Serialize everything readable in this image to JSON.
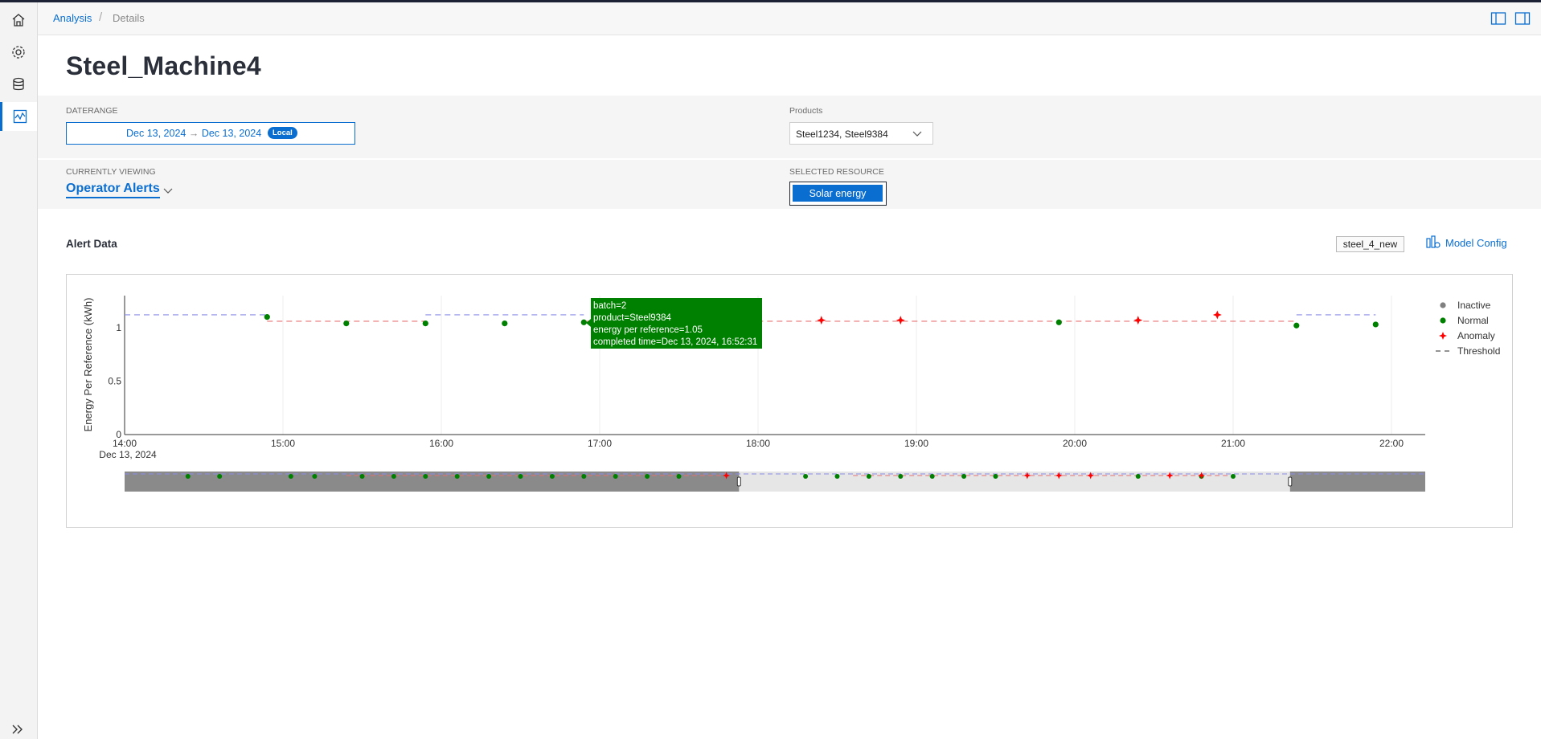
{
  "breadcrumb": {
    "link": "Analysis",
    "separator": "/",
    "current": "Details"
  },
  "page_title": "Steel_Machine4",
  "filters": {
    "daterange_label": "DATERANGE",
    "date_from": "Dec 13, 2024",
    "date_arrow": "→",
    "date_to": "Dec 13, 2024",
    "timezone_badge": "Local",
    "products_label": "Products",
    "products_value": "Steel1234, Steel9384",
    "viewing_label": "CURRENTLY VIEWING",
    "viewing_value": "Operator Alerts",
    "resource_label": "SELECTED RESOURCE",
    "resource_value": "Solar energy"
  },
  "section": {
    "title": "Alert Data",
    "model_tag": "steel_4_new",
    "model_config": "Model Config"
  },
  "tooltip": {
    "lines": [
      "batch=2",
      "product=Steel9384",
      "energy per reference=1.05",
      "completed time=Dec 13, 2024, 16:52:31"
    ],
    "color": "#008000"
  },
  "icons": {
    "sidebar": [
      "home-icon",
      "gear-icon",
      "database-icon",
      "activity-chart-icon"
    ],
    "header": [
      "panel-left-icon",
      "panel-right-icon"
    ],
    "collapse": "double-chevron-right-icon"
  },
  "colors": {
    "accent": "#0a6ed1",
    "normal": "#008000",
    "anomaly": "#ff0000",
    "inactive": "#808080"
  },
  "chart_data": {
    "type": "scatter",
    "ylabel": "Energy Per Reference (kWh)",
    "xlabel": "",
    "x_date_label": "Dec 13, 2024",
    "x_ticks": [
      "14:00",
      "15:00",
      "16:00",
      "17:00",
      "18:00",
      "19:00",
      "20:00",
      "21:00",
      "22:00"
    ],
    "y_ticks": [
      "0",
      "0.5",
      "1"
    ],
    "ylim": [
      0,
      1.3
    ],
    "xlim": [
      14.0,
      22.2
    ],
    "grid": "vertical",
    "legend": [
      "Inactive",
      "Normal",
      "Anomaly",
      "Threshold"
    ],
    "legend_position": "top-right",
    "series": [
      {
        "name": "Normal",
        "points": [
          [
            14.9,
            1.1
          ],
          [
            15.4,
            1.04
          ],
          [
            15.9,
            1.04
          ],
          [
            16.4,
            1.04
          ],
          [
            16.9,
            1.05
          ],
          [
            19.9,
            1.05
          ],
          [
            21.4,
            1.02
          ],
          [
            21.9,
            1.03
          ]
        ]
      },
      {
        "name": "Anomaly",
        "points": [
          [
            18.4,
            1.07
          ],
          [
            18.9,
            1.07
          ],
          [
            20.4,
            1.07
          ],
          [
            20.9,
            1.12
          ]
        ]
      },
      {
        "name": "Threshold",
        "segments": [
          {
            "x": [
              14.0,
              14.9
            ],
            "y": 1.12,
            "color": "#8c8ce8"
          },
          {
            "x": [
              14.9,
              15.9
            ],
            "y": 1.06,
            "color": "#e87070"
          },
          {
            "x": [
              15.9,
              16.9
            ],
            "y": 1.12,
            "color": "#8c8ce8"
          },
          {
            "x": [
              16.9,
              21.4
            ],
            "y": 1.06,
            "color": "#e87070"
          },
          {
            "x": [
              21.4,
              21.9
            ],
            "y": 1.12,
            "color": "#8c8ce8"
          }
        ]
      }
    ],
    "overview": {
      "range_start": 14.0,
      "range_end": 22.2,
      "selected": [
        17.9,
        21.4
      ],
      "normal_x": [
        14.4,
        14.6,
        15.05,
        15.2,
        15.5,
        15.7,
        15.9,
        16.1,
        16.3,
        16.5,
        16.7,
        16.9,
        17.1,
        17.3,
        17.5,
        18.3,
        18.5,
        18.7,
        18.9,
        19.1,
        19.3,
        19.5,
        20.4,
        20.8,
        21.0
      ],
      "anomaly_x": [
        17.8,
        19.7,
        19.9,
        20.1,
        20.6,
        20.8
      ]
    }
  }
}
